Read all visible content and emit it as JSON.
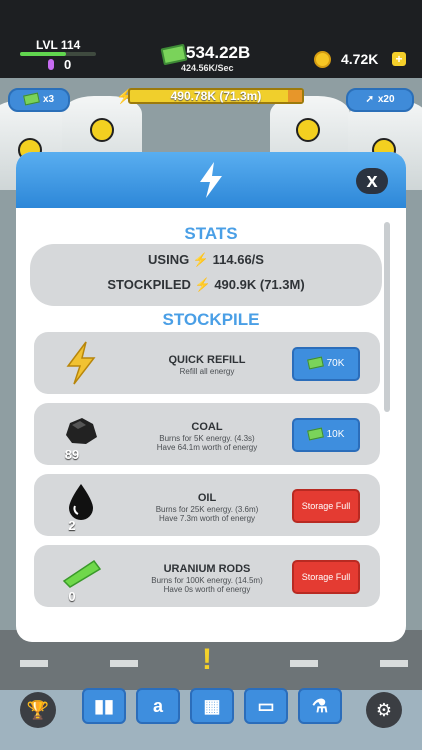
{
  "topbar": {
    "level_label": "LVL 114",
    "gems": "0",
    "cash": "534.22B",
    "cash_rate": "424.56K/Sec",
    "coins": "4.72K",
    "plus": "+"
  },
  "hud": {
    "left_pill": "x3",
    "energy_bar_text": "490.78K (71.3m)",
    "right_pill": "x20",
    "energy_fill_fraction": 0.92
  },
  "modal": {
    "stats_title": "STATS",
    "using_label": "USING",
    "using_value": "114.66/S",
    "stockpiled_label": "STOCKPILED",
    "stockpiled_value": "490.9K (71.3M)",
    "stockpile_title": "STOCKPILE",
    "items": [
      {
        "title": "QUICK REFILL",
        "desc1": "Refill all energy",
        "desc2": "",
        "count": "",
        "button": "70K",
        "button_type": "cash"
      },
      {
        "title": "COAL",
        "desc1": "Burns for 5K energy. (4.3s)",
        "desc2": "Have 64.1m worth of energy",
        "count": "89",
        "button": "10K",
        "button_type": "cash"
      },
      {
        "title": "OIL",
        "desc1": "Burns for 25K energy. (3.6m)",
        "desc2": "Have 7.3m worth of energy",
        "count": "2",
        "button": "Storage Full",
        "button_type": "full"
      },
      {
        "title": "URANIUM RODS",
        "desc1": "Burns for 100K energy. (14.5m)",
        "desc2": "Have 0s worth of energy",
        "count": "0",
        "button": "Storage Full",
        "button_type": "full"
      }
    ],
    "close_icon": "x",
    "colors": {
      "accent": "#4a9fe6",
      "full": "#e43b32"
    }
  },
  "nav": {
    "icons": [
      "trophy-icon",
      "chart-icon",
      "amazon-icon",
      "building-icon",
      "briefcase-icon",
      "flask-icon",
      "gear-icon"
    ]
  }
}
